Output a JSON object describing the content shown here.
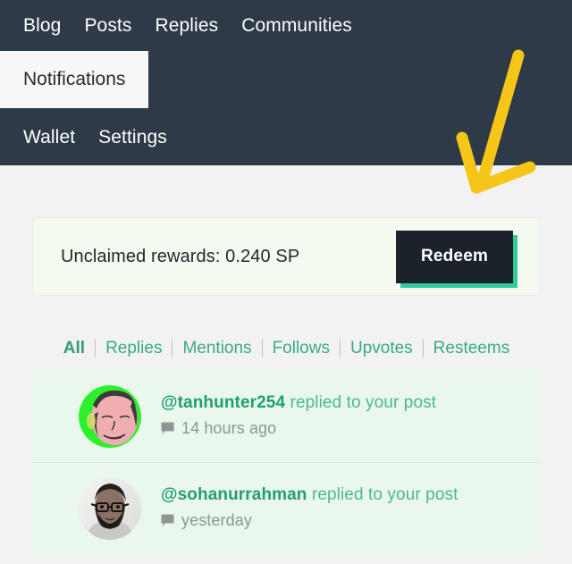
{
  "header": {
    "nav_primary": [
      {
        "label": "Blog"
      },
      {
        "label": "Posts"
      },
      {
        "label": "Replies"
      },
      {
        "label": "Communities"
      }
    ],
    "nav_active": {
      "label": "Notifications"
    },
    "nav_secondary": [
      {
        "label": "Wallet"
      },
      {
        "label": "Settings"
      }
    ],
    "background_color": "#2e3a47"
  },
  "annotation": {
    "name": "yellow-arrow",
    "color": "#f5c518",
    "points_to": "Notifications tab"
  },
  "rewards": {
    "text": "Unclaimed rewards: 0.240 SP",
    "amount": "0.240",
    "currency": "SP",
    "redeem_label": "Redeem",
    "banner_color": "#f4faf0",
    "button_color": "#1b222a",
    "button_shadow_color": "#2ecc9b"
  },
  "filters": {
    "accent_color": "#3aab7d",
    "tabs": [
      {
        "label": "All",
        "active": true
      },
      {
        "label": "Replies",
        "active": false
      },
      {
        "label": "Mentions",
        "active": false
      },
      {
        "label": "Follows",
        "active": false
      },
      {
        "label": "Upvotes",
        "active": false
      },
      {
        "label": "Resteems",
        "active": false
      }
    ]
  },
  "notifications": {
    "row_color": "#e9f7ec",
    "items": [
      {
        "username": "@tanhunter254",
        "action": "replied to your post",
        "time": "14 hours ago",
        "icon": "speech-bubble-icon",
        "avatar": "cartoon-face-green-background"
      },
      {
        "username": "@sohanurrahman",
        "action": "replied to your post",
        "time": "yesterday",
        "icon": "speech-bubble-icon",
        "avatar": "photo-bearded-man-glasses"
      }
    ]
  }
}
